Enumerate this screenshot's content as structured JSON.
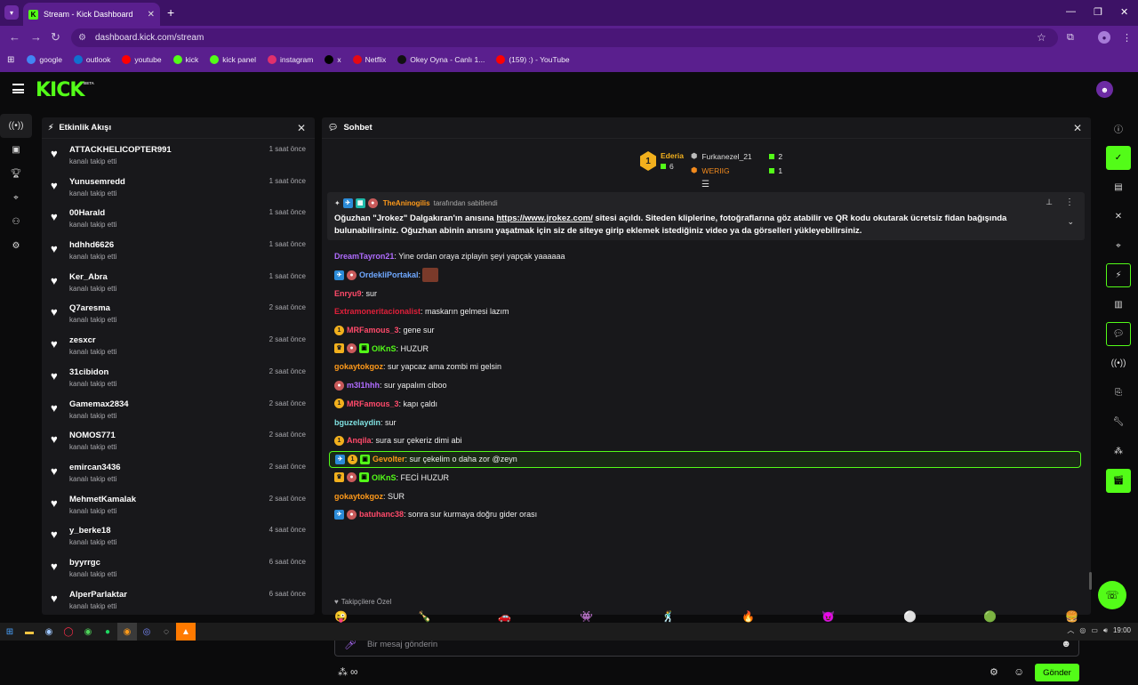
{
  "browser": {
    "tab_title": "Stream - Kick Dashboard",
    "url": "dashboard.kick.com/stream",
    "bookmarks": [
      {
        "label": "google",
        "color": "#4285f4"
      },
      {
        "label": "outlook",
        "color": "#1170cf"
      },
      {
        "label": "youtube",
        "color": "#ff0000"
      },
      {
        "label": "kick",
        "color": "#53fc18"
      },
      {
        "label": "kick panel",
        "color": "#53fc18"
      },
      {
        "label": "instagram",
        "color": "#e1306c"
      },
      {
        "label": "x",
        "color": "#000000"
      },
      {
        "label": "Netflix",
        "color": "#e50914"
      },
      {
        "label": "Okey Oyna - Canlı 1...",
        "color": "#111111"
      },
      {
        "label": "(159) :) - YouTube",
        "color": "#ff0000"
      }
    ]
  },
  "kick": {
    "logo": "KICK",
    "beta": "BETA"
  },
  "activity": {
    "title": "Etkinlik Akışı",
    "events": [
      {
        "name": "ATTACKHELICOPTER991",
        "action": "kanalı takip etti",
        "time": "1 saat önce"
      },
      {
        "name": "Yunusemredd",
        "action": "kanalı takip etti",
        "time": "1 saat önce"
      },
      {
        "name": "00Harald",
        "action": "kanalı takip etti",
        "time": "1 saat önce"
      },
      {
        "name": "hdhhd6626",
        "action": "kanalı takip etti",
        "time": "1 saat önce"
      },
      {
        "name": "Ker_Abra",
        "action": "kanalı takip etti",
        "time": "1 saat önce"
      },
      {
        "name": "Q7aresma",
        "action": "kanalı takip etti",
        "time": "2 saat önce"
      },
      {
        "name": "zesxcr",
        "action": "kanalı takip etti",
        "time": "2 saat önce"
      },
      {
        "name": "31cibidon",
        "action": "kanalı takip etti",
        "time": "2 saat önce"
      },
      {
        "name": "Gamemax2834",
        "action": "kanalı takip etti",
        "time": "2 saat önce"
      },
      {
        "name": "NOMOS771",
        "action": "kanalı takip etti",
        "time": "2 saat önce"
      },
      {
        "name": "emircan3436",
        "action": "kanalı takip etti",
        "time": "2 saat önce"
      },
      {
        "name": "MehmetKamalak",
        "action": "kanalı takip etti",
        "time": "2 saat önce"
      },
      {
        "name": "y_berke18",
        "action": "kanalı takip etti",
        "time": "4 saat önce"
      },
      {
        "name": "byyrrgc",
        "action": "kanalı takip etti",
        "time": "6 saat önce"
      },
      {
        "name": "AlperParlaktar",
        "action": "kanalı takip etti",
        "time": "6 saat önce"
      }
    ]
  },
  "chat": {
    "title": "Sohbet",
    "leaderboard": {
      "first": {
        "rank": "1",
        "name": "Ederia",
        "count": "6"
      },
      "second": {
        "name": "Furkanezel_21",
        "count": "2"
      },
      "third": {
        "name": "WERIIG",
        "count": "1"
      }
    },
    "pinned": {
      "author": "TheAninogilis",
      "suffix": "tarafından sabitlendi",
      "text_a": "Oğuzhan \"Jrokez\" Dalgakıran'ın anısına ",
      "link": "https://www.jrokez.com/",
      "text_b": " sitesi açıldı. Siteden kliplerine, fotoğraflarına göz atabilir ve QR kodu okutarak ücretsiz fidan bağışında bulunabilirsiniz. Oğuzhan abinin anısını yaşatmak için siz de siteye girip eklemek istediğiniz video ya da görselleri yükleyebilirsiniz."
    },
    "messages": [
      {
        "user": "DreamTayron21",
        "color": "#b06cff",
        "text": ": Yine ordan oraya ziplayin şeyi yapçak yaaaaaa",
        "badges": []
      },
      {
        "user": "OrdekliPortakal",
        "color": "#6fa8ff",
        "text": ": ",
        "badges": [
          "blue",
          "ava"
        ]
      },
      {
        "user": "Enryu9",
        "color": "#ff4a6a",
        "text": ": sur",
        "badges": []
      },
      {
        "user": "Extramoneritacionalist",
        "color": "#e0203a",
        "text": ": maskarın gelmesi lazım",
        "badges": []
      },
      {
        "user": "MRFamous_3",
        "color": "#ff4a6a",
        "text": ": gene sur",
        "badges": [
          "gold"
        ]
      },
      {
        "user": "OlKnS",
        "color": "#53fc18",
        "text": ": HUZUR",
        "badges": [
          "crown",
          "ava",
          "grn"
        ]
      },
      {
        "user": "gokaytokgoz",
        "color": "#ff9a1a",
        "text": ": sur yapcaz ama zombi mi gelsin",
        "badges": []
      },
      {
        "user": "m3l1hhh",
        "color": "#b06cff",
        "text": ": sur yapalım ciboo",
        "badges": [
          "ava"
        ]
      },
      {
        "user": "MRFamous_3",
        "color": "#ff4a6a",
        "text": ": kapı çaldı",
        "badges": [
          "gold"
        ]
      },
      {
        "user": "bguzelaydin",
        "color": "#7fe0e0",
        "text": ": sur",
        "badges": []
      },
      {
        "user": "Anqila",
        "color": "#ff4a6a",
        "text": ": sura sur çekeriz dimi abi",
        "badges": [
          "gold"
        ]
      },
      {
        "user": "Gevolter",
        "color": "#ff9a1a",
        "text": ": sur çekelim o daha zor @zeyn",
        "badges": [
          "blue",
          "gold",
          "grn"
        ],
        "highlight": true
      },
      {
        "user": "OlKnS",
        "color": "#53fc18",
        "text": ": FECİ HUZUR",
        "badges": [
          "crown",
          "ava",
          "grn"
        ]
      },
      {
        "user": "gokaytokgoz",
        "color": "#ff9a1a",
        "text": ": SUR",
        "badges": []
      },
      {
        "user": "batuhanc38",
        "color": "#ff4a6a",
        "text": ": sonra sur kurmaya doğru gider orası",
        "badges": [
          "blue",
          "ava"
        ]
      }
    ],
    "followers_only": "Takipçilere Özel",
    "input_placeholder": "Bir mesaj gönderin",
    "send_label": "Gönder"
  },
  "taskbar": {
    "time": "19:00"
  }
}
